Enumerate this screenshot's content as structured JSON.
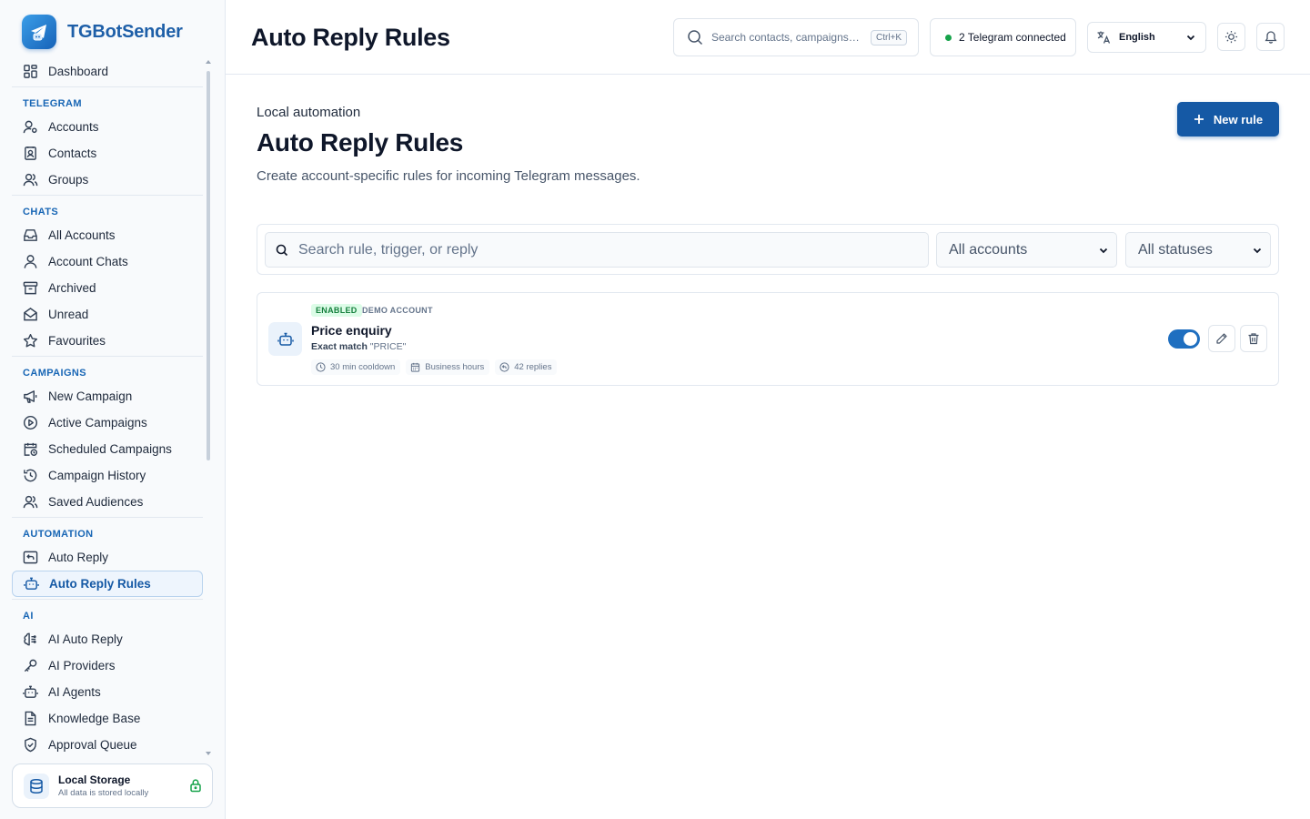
{
  "brand": {
    "name": "TGBotSender"
  },
  "sidebar": {
    "top": {
      "label": "Dashboard"
    },
    "telegram": {
      "title": "TELEGRAM",
      "items": [
        {
          "label": "Accounts"
        },
        {
          "label": "Contacts"
        },
        {
          "label": "Groups"
        }
      ]
    },
    "chats": {
      "title": "CHATS",
      "items": [
        {
          "label": "All Accounts"
        },
        {
          "label": "Account Chats"
        },
        {
          "label": "Archived"
        },
        {
          "label": "Unread"
        },
        {
          "label": "Favourites"
        }
      ]
    },
    "campaigns": {
      "title": "CAMPAIGNS",
      "items": [
        {
          "label": "New Campaign"
        },
        {
          "label": "Active Campaigns"
        },
        {
          "label": "Scheduled Campaigns"
        },
        {
          "label": "Campaign History"
        },
        {
          "label": "Saved Audiences"
        }
      ]
    },
    "automation": {
      "title": "AUTOMATION",
      "items": [
        {
          "label": "Auto Reply"
        },
        {
          "label": "Auto Reply Rules",
          "active": true
        }
      ]
    },
    "ai": {
      "title": "AI",
      "items": [
        {
          "label": "AI Auto Reply"
        },
        {
          "label": "AI Providers"
        },
        {
          "label": "AI Agents"
        },
        {
          "label": "Knowledge Base"
        },
        {
          "label": "Approval Queue"
        }
      ]
    },
    "storage": {
      "title": "Local Storage",
      "subtitle": "All data is stored locally"
    }
  },
  "header": {
    "title": "Auto Reply Rules",
    "search_placeholder": "Search contacts, campaigns, t...",
    "shortcut": "Ctrl+K",
    "connection": "2 Telegram connected",
    "language": "English"
  },
  "page": {
    "eyebrow": "Local automation",
    "title": "Auto Reply Rules",
    "description": "Create account-specific rules for incoming Telegram messages.",
    "new_rule_label": "New rule"
  },
  "filters": {
    "search_placeholder": "Search rule, trigger, or reply",
    "accounts": "All accounts",
    "statuses": "All statuses"
  },
  "rules": [
    {
      "status": "ENABLED",
      "account": "DEMO ACCOUNT",
      "name": "Price enquiry",
      "match_type": "Exact match",
      "trigger": "\"PRICE\"",
      "cooldown": "30 min cooldown",
      "schedule": "Business hours",
      "replies": "42 replies",
      "enabled": true
    }
  ],
  "colors": {
    "accent": "#1559a5",
    "brand": "#1e5fa8",
    "status_enabled": "#15803d",
    "connected": "#16a34a"
  }
}
